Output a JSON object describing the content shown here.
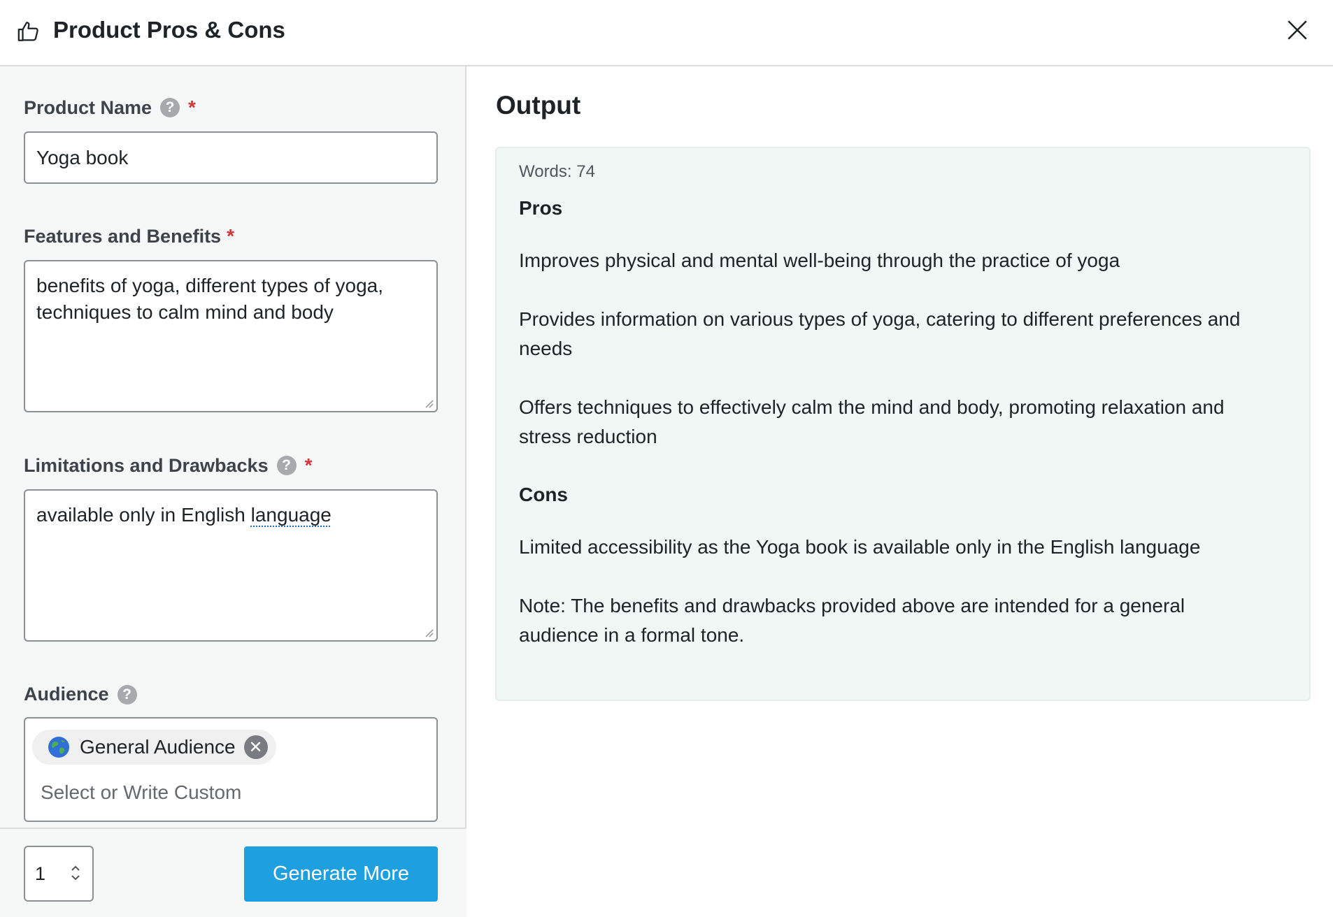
{
  "header": {
    "title": "Product Pros & Cons",
    "icon": "thumbs-up-icon",
    "close_icon": "close-icon"
  },
  "form": {
    "product_name": {
      "label": "Product Name",
      "required": "*",
      "value": "Yoga book"
    },
    "features": {
      "label": "Features and Benefits",
      "required": "*",
      "value_line1": "benefits of yoga, different types of yoga,",
      "value_line2": "techniques to calm mind and body"
    },
    "limitations": {
      "label": "Limitations and Drawbacks",
      "required": "*",
      "value_prefix": "available only in English ",
      "value_underlined": "language"
    },
    "audience": {
      "label": "Audience",
      "chip_label": "General Audience",
      "chip_icon": "globe-icon",
      "placeholder": "Select or Write Custom"
    },
    "help_glyph": "?"
  },
  "footer": {
    "count_value": "1",
    "generate_label": "Generate More"
  },
  "output": {
    "title": "Output",
    "words": "Words: 74",
    "pros_heading": "Pros",
    "pro1": "Improves physical and mental well-being through the practice of yoga",
    "pro2_line1": "Provides information on various types of yoga, catering to different preferences and",
    "pro2_line2": "needs",
    "pro3_line1": "Offers techniques to effectively calm the mind and body, promoting relaxation and",
    "pro3_line2": "stress reduction",
    "cons_heading": "Cons",
    "con1": "Limited accessibility as the Yoga book is available only in the English language",
    "note_line1": "Note: The benefits and drawbacks provided above are intended for a general",
    "note_line2": "audience in a formal tone."
  },
  "colors": {
    "accent": "#1e9fe0",
    "required": "#d63638",
    "output_bg": "#f0f7f4",
    "panel_bg": "#f6f7f7"
  }
}
